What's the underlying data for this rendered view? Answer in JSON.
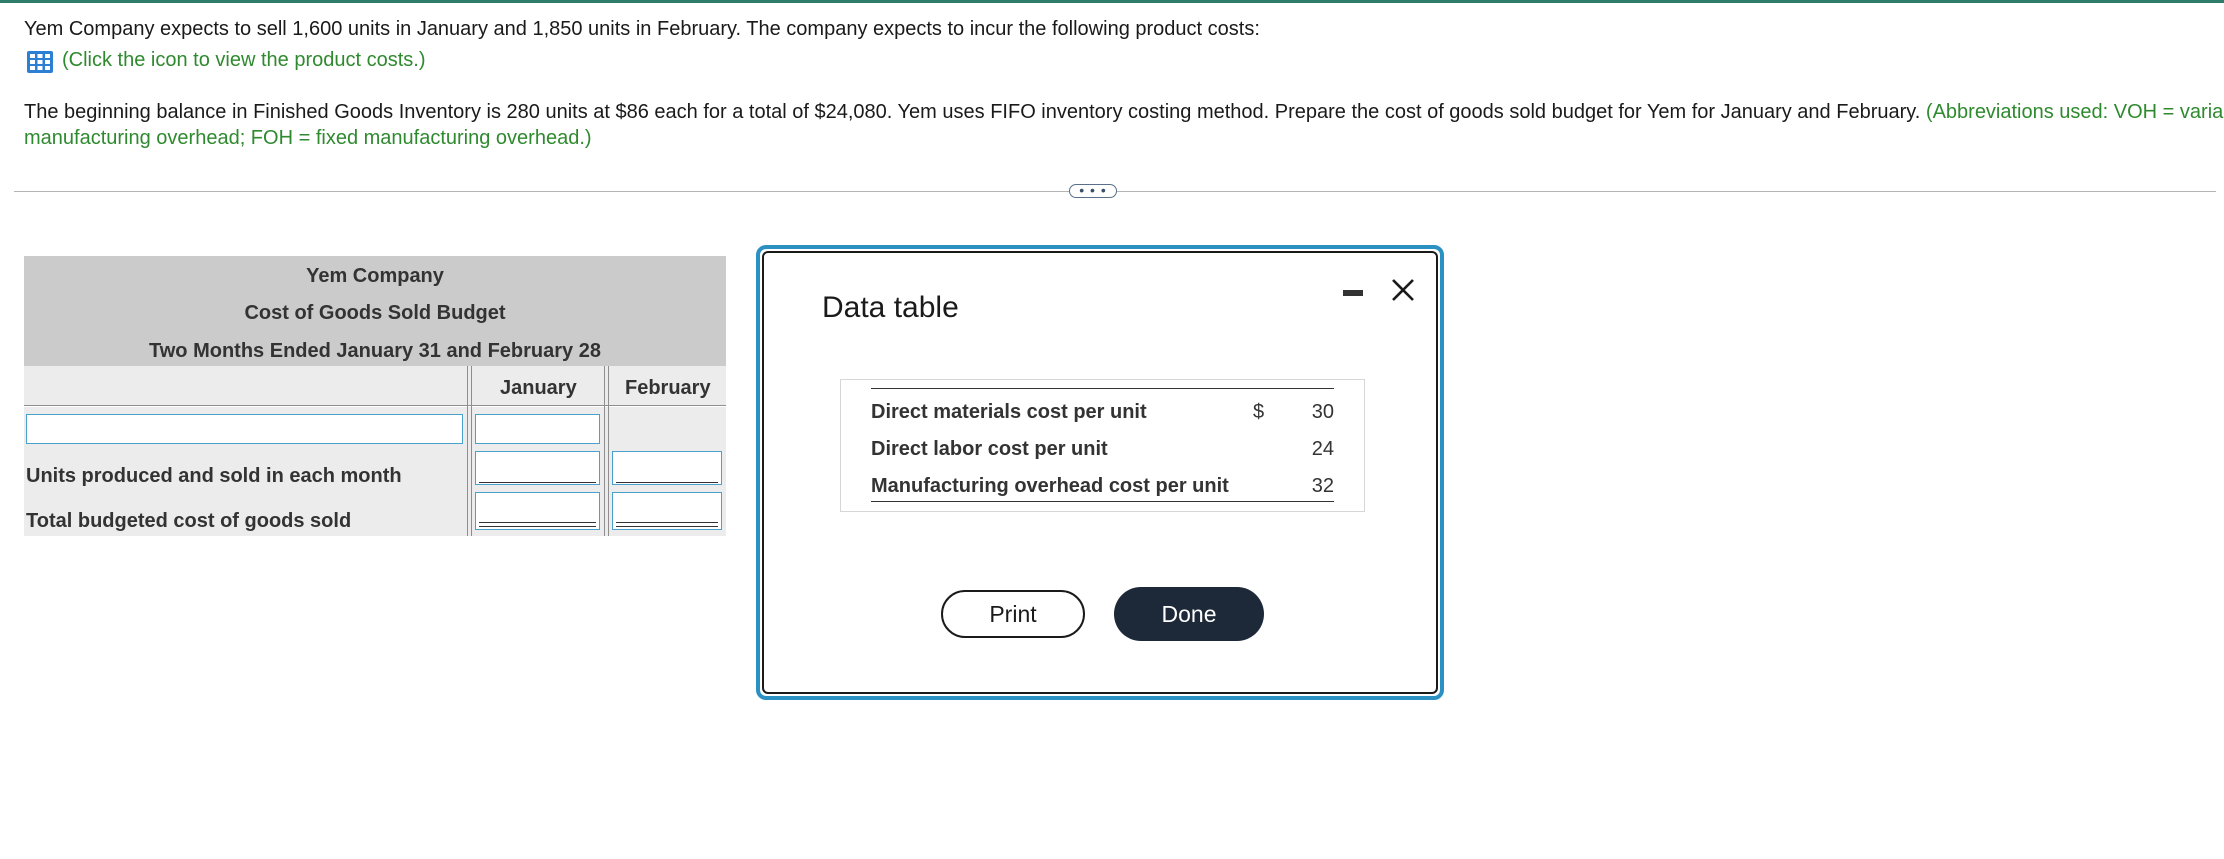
{
  "question": {
    "line1": "Yem Company expects to sell 1,600 units in January and 1,850 units in February. The company expects to incur the following product costs:",
    "icon_link": "(Click the icon to view the product costs.)",
    "para_main": "The beginning balance in Finished Goods Inventory is 280 units at $86 each for a total of $24,080. Yem uses FIFO inventory costing method. Prepare the cost of goods sold budget for Yem for January and February. ",
    "para_green_a": "(Abbreviations used: VOH = variable",
    "para_green_b": "manufacturing overhead; FOH = fixed manufacturing overhead.)"
  },
  "expand_button": "• • •",
  "budget": {
    "company": "Yem Company",
    "title": "Cost of Goods Sold Budget",
    "period": "Two Months Ended January 31 and February 28",
    "columns": [
      "January",
      "February"
    ],
    "rows": [
      {
        "label": "Units produced and sold in each month"
      },
      {
        "label": "Total budgeted cost of goods sold"
      }
    ]
  },
  "modal": {
    "title": "Data table",
    "currency": "$",
    "rows": [
      {
        "label": "Direct materials cost per unit",
        "value": "30"
      },
      {
        "label": "Direct labor cost per unit",
        "value": "24"
      },
      {
        "label": "Manufacturing overhead cost per unit",
        "value": "32"
      }
    ],
    "print_label": "Print",
    "done_label": "Done"
  },
  "icons": {
    "table_icon": "table-grid-icon",
    "minimize": "minimize-icon",
    "close": "close-icon"
  },
  "colors": {
    "accent_green": "#2f8a2f",
    "modal_border": "#2b90c2",
    "done_button": "#1d2939",
    "input_border": "#4aa1c9"
  }
}
